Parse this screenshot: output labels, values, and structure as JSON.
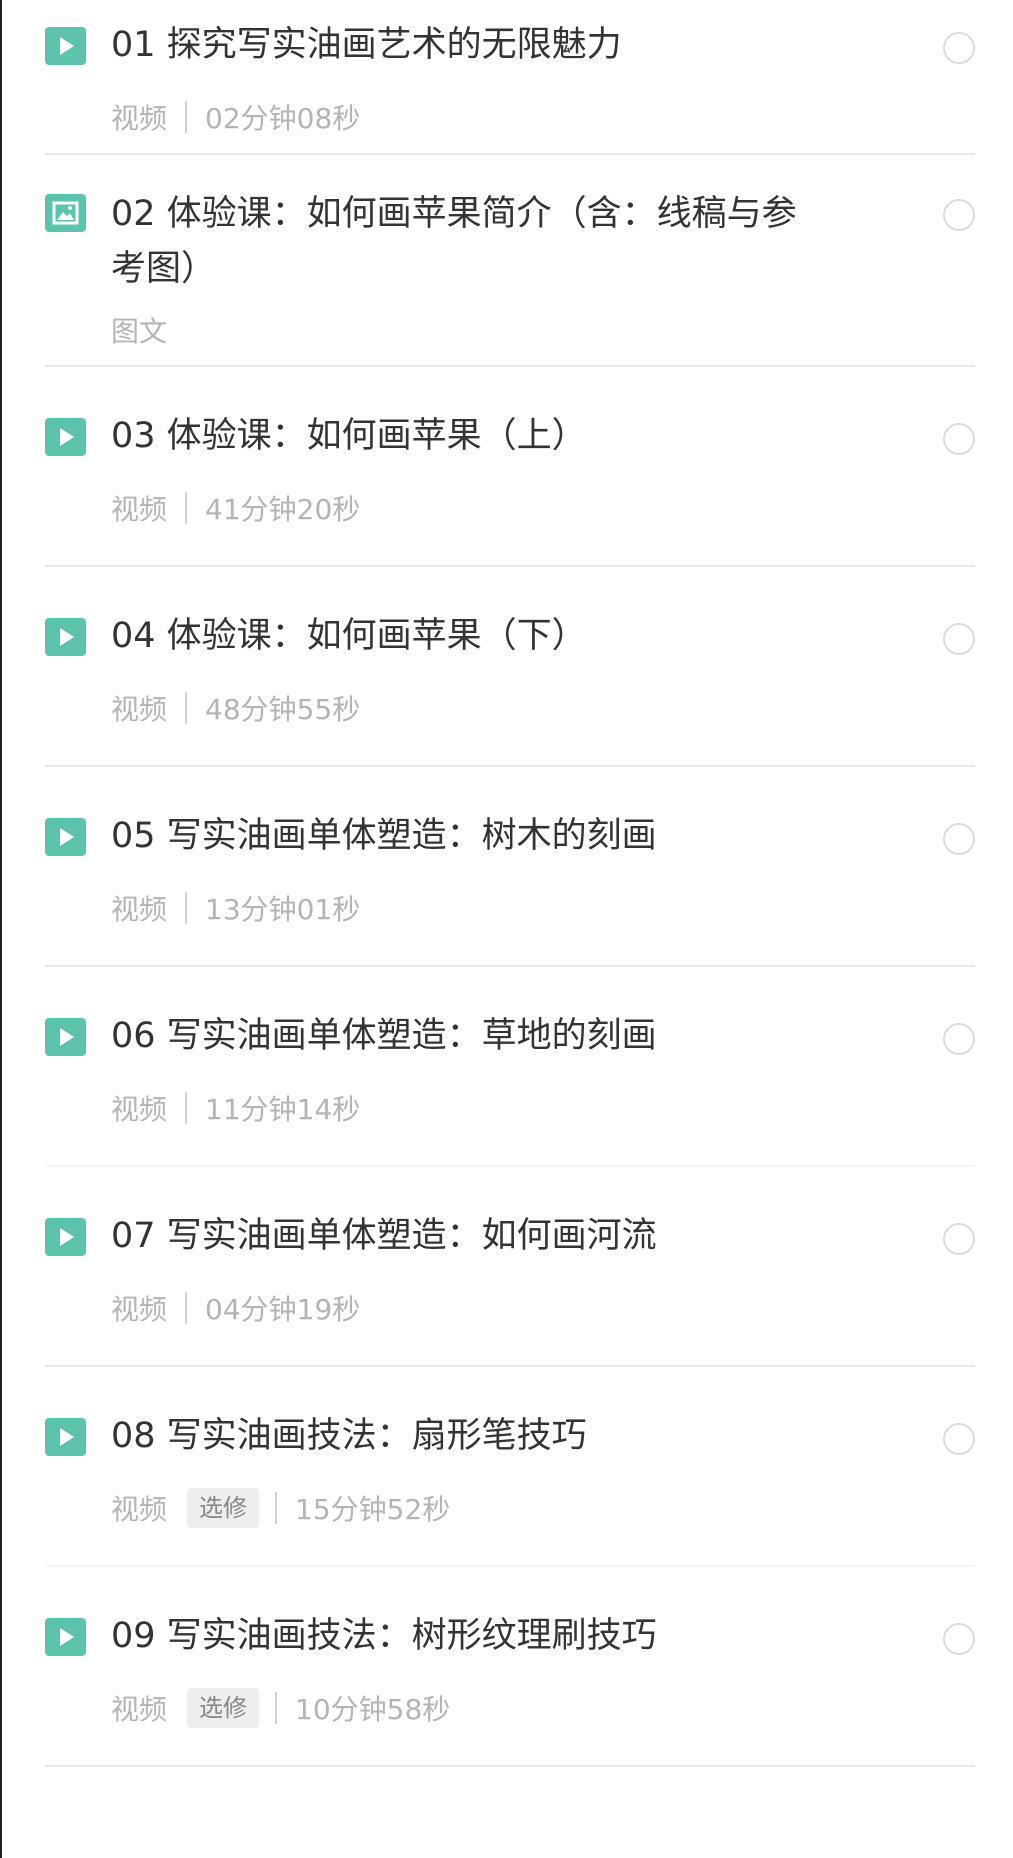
{
  "lessons": [
    {
      "title": "01 探究写实油画艺术的无限魅力",
      "type": "视频",
      "tag": "",
      "duration": "02分钟08秒",
      "icon": "play-icon"
    },
    {
      "title": "02 体验课：如何画苹果简介（含：线稿与参考图）",
      "type": "图文",
      "tag": "",
      "duration": "",
      "icon": "image-icon"
    },
    {
      "title": "03 体验课：如何画苹果（上）",
      "type": "视频",
      "tag": "",
      "duration": "41分钟20秒",
      "icon": "play-icon"
    },
    {
      "title": "04 体验课：如何画苹果（下）",
      "type": "视频",
      "tag": "",
      "duration": "48分钟55秒",
      "icon": "play-icon"
    },
    {
      "title": "05 写实油画单体塑造：树木的刻画",
      "type": "视频",
      "tag": "",
      "duration": "13分钟01秒",
      "icon": "play-icon"
    },
    {
      "title": "06 写实油画单体塑造：草地的刻画",
      "type": "视频",
      "tag": "",
      "duration": "11分钟14秒",
      "icon": "play-icon"
    },
    {
      "title": "07 写实油画单体塑造：如何画河流",
      "type": "视频",
      "tag": "",
      "duration": "04分钟19秒",
      "icon": "play-icon"
    },
    {
      "title": "08 写实油画技法：扇形笔技巧",
      "type": "视频",
      "tag": "选修",
      "duration": "15分钟52秒",
      "icon": "play-icon"
    },
    {
      "title": "09 写实油画技法：树形纹理刷技巧",
      "type": "视频",
      "tag": "选修",
      "duration": "10分钟58秒",
      "icon": "play-icon"
    }
  ],
  "colors": {
    "icon": "#5ec3ad",
    "title": "#333333",
    "meta": "#b4b4b4",
    "divider": "#e8e8e8",
    "status_ring": "#dcdcdc"
  }
}
